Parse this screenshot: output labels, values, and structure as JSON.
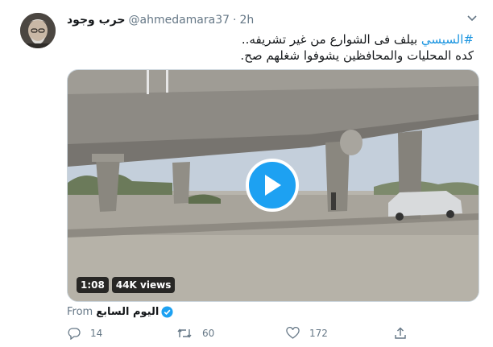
{
  "tweet": {
    "display_name": "حرب وجود",
    "handle": "@ahmedamara37",
    "separator": "·",
    "time": "2h",
    "hashtag": "#السيسي",
    "text_line1_rest": " بيلف فى الشوارع من غير تشريفه..",
    "text_line2": "كده المحليات والمحافظين يشوفوا شغلهم صح."
  },
  "video": {
    "duration": "1:08",
    "views": "44K views"
  },
  "source": {
    "from_label": "From",
    "name": "اليوم السابع"
  },
  "actions": {
    "replies": "14",
    "retweets": "60",
    "likes": "172"
  },
  "icons": {
    "caret": "chevron-down-icon",
    "play": "play-icon",
    "verified": "verified-badge-icon",
    "reply": "reply-icon",
    "retweet": "retweet-icon",
    "like": "heart-icon",
    "share": "share-icon"
  },
  "colors": {
    "link": "#1b95e0",
    "play": "#1da1f2",
    "muted": "#657786"
  }
}
